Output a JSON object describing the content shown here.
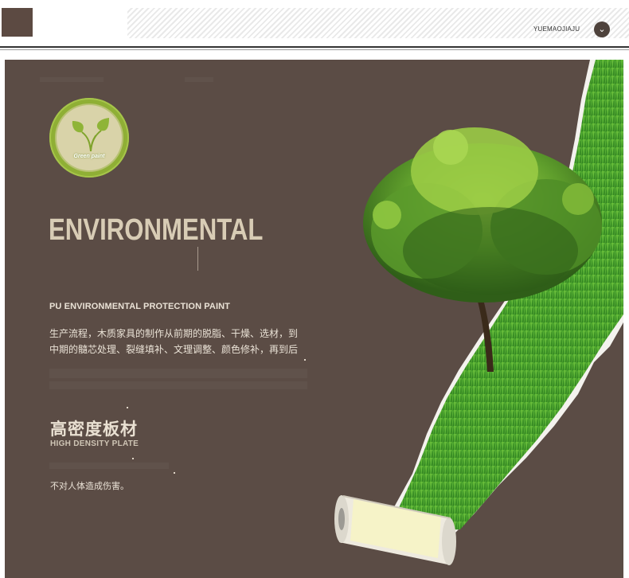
{
  "header": {
    "brand": "YUEMAOJIAJU",
    "chevron_glyph": "⌄"
  },
  "badge": {
    "text": "Green paint",
    "icon": "leaf-icon"
  },
  "headline": "ENVIRONMENTAL",
  "subhead": "PU ENVIRONMENTAL PROTECTION PAINT",
  "body_lines": [
    "生产流程，木质家具的制作从前期的脱脂、干燥、选材，到",
    "中期的髓芯处理、裂缝填补、文理调整、颜色修补，再到后"
  ],
  "section": {
    "title_cn": "高密度板材",
    "title_en": "HIGH DENSITY PLATE",
    "footnote": "不对人体造成伤害。"
  },
  "colors": {
    "panel_brown": "#5b4c45",
    "header_square": "#5c4a42",
    "accent_green": "#8faf35",
    "headline_beige": "#d8ccb5"
  }
}
